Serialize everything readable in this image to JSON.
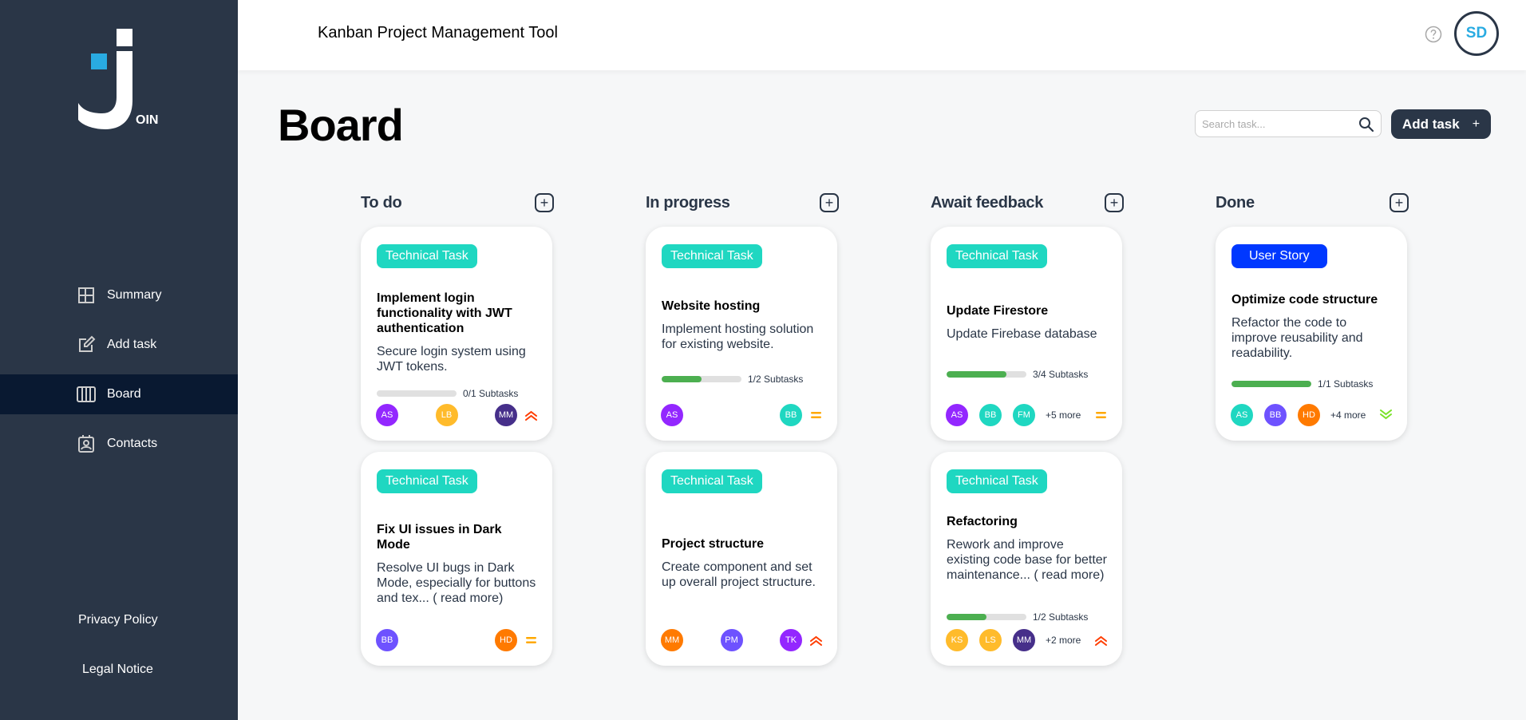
{
  "app": {
    "title": "Kanban Project Management Tool",
    "user_initials": "SD"
  },
  "logo": {
    "letter": "OIN"
  },
  "nav": [
    {
      "label": "Summary",
      "icon": "summary-icon"
    },
    {
      "label": "Add task",
      "icon": "edit-icon"
    },
    {
      "label": "Board",
      "icon": "board-icon",
      "active": true
    },
    {
      "label": "Contacts",
      "icon": "contacts-icon"
    }
  ],
  "footer_links": {
    "privacy": "Privacy Policy",
    "legal": "Legal Notice"
  },
  "board": {
    "title": "Board",
    "search_placeholder": "Search task...",
    "add_task_label": "Add task",
    "add_task_plus": "+"
  },
  "colors": {
    "sidebar": "#2a3647",
    "active_nav": "#091931",
    "technical_task": "#1fd7c1",
    "user_story": "#0038ff",
    "progress": "#4caf50",
    "urgent": "#ff3d00",
    "medium": "#ffa800",
    "low": "#7ae229"
  },
  "columns": [
    {
      "title": "To do",
      "add": "+",
      "cards": [
        {
          "category": "Technical Task",
          "title": "Implement login functionality with JWT authentication",
          "description": "Secure login system using JWT tokens.",
          "progress": {
            "done": 0,
            "total": 1,
            "label": "0/1 Subtasks"
          },
          "assignees": [
            {
              "initials": "AS",
              "color": "#9327ff"
            },
            {
              "initials": "LB",
              "color": "#ffbb2b"
            },
            {
              "initials": "MM",
              "color": "#462f8a"
            }
          ],
          "more": "",
          "priority": "urgent"
        },
        {
          "category": "Technical Task",
          "title": "Fix UI issues in Dark Mode",
          "description": "Resolve UI bugs in Dark Mode, especially for buttons and tex... ( read more)",
          "progress": null,
          "assignees": [
            {
              "initials": "BB",
              "color": "#6e52ff"
            },
            {
              "initials": "HD",
              "color": "#ff7a00"
            }
          ],
          "more": "",
          "priority": "medium"
        }
      ]
    },
    {
      "title": "In progress",
      "add": "+",
      "cards": [
        {
          "category": "Technical Task",
          "title": "Website hosting",
          "description": "Implement hosting solution for existing website.",
          "progress": {
            "done": 1,
            "total": 2,
            "label": "1/2 Subtasks"
          },
          "assignees": [
            {
              "initials": "AS",
              "color": "#9327ff"
            },
            {
              "initials": "BB",
              "color": "#1fd7c1"
            }
          ],
          "more": "",
          "priority": "medium"
        },
        {
          "category": "Technical Task",
          "title": "Project structure",
          "description": "Create component and set up overall project structure.",
          "progress": null,
          "assignees": [
            {
              "initials": "MM",
              "color": "#ff7a00"
            },
            {
              "initials": "PM",
              "color": "#6e52ff"
            },
            {
              "initials": "TK",
              "color": "#9327ff"
            }
          ],
          "more": "",
          "priority": "urgent"
        }
      ]
    },
    {
      "title": "Await feedback",
      "add": "+",
      "cards": [
        {
          "category": "Technical Task",
          "title": "Update Firestore",
          "description": "Update Firebase database",
          "progress": {
            "done": 3,
            "total": 4,
            "label": "3/4 Subtasks"
          },
          "assignees": [
            {
              "initials": "AS",
              "color": "#9327ff"
            },
            {
              "initials": "BB",
              "color": "#1fd7c1"
            },
            {
              "initials": "FM",
              "color": "#1fd7c1"
            }
          ],
          "more": "+5 more",
          "priority": "medium"
        },
        {
          "category": "Technical Task",
          "title": "Refactoring",
          "description": "Rework and improve existing code base for better maintenance... ( read more)",
          "progress": {
            "done": 1,
            "total": 2,
            "label": "1/2 Subtasks"
          },
          "assignees": [
            {
              "initials": "KS",
              "color": "#ffbb2b"
            },
            {
              "initials": "LS",
              "color": "#ffbb2b"
            },
            {
              "initials": "MM",
              "color": "#462f8a"
            }
          ],
          "more": "+2 more",
          "priority": "urgent"
        }
      ]
    },
    {
      "title": "Done",
      "add": "+",
      "cards": [
        {
          "category": "User Story",
          "title": "Optimize code structure",
          "description": "Refactor the code to improve reusability and readability.",
          "progress": {
            "done": 1,
            "total": 1,
            "label": "1/1 Subtasks"
          },
          "assignees": [
            {
              "initials": "AS",
              "color": "#1fd7c1"
            },
            {
              "initials": "BB",
              "color": "#6e52ff"
            },
            {
              "initials": "HD",
              "color": "#ff7a00"
            }
          ],
          "more": "+4 more",
          "priority": "low"
        }
      ]
    }
  ]
}
